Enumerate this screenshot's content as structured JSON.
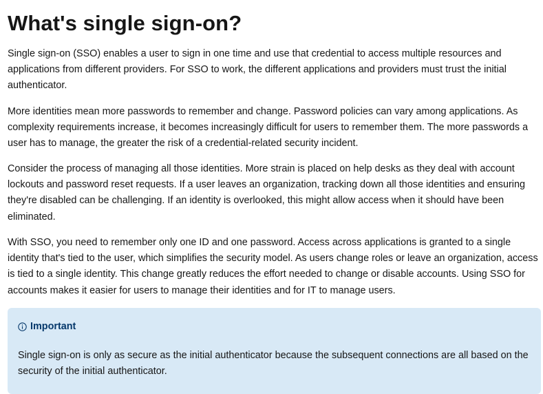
{
  "heading": "What's single sign-on?",
  "paragraphs": [
    "Single sign-on (SSO) enables a user to sign in one time and use that credential to access multiple resources and applications from different providers. For SSO to work, the different applications and providers must trust the initial authenticator.",
    "More identities mean more passwords to remember and change. Password policies can vary among applications. As complexity requirements increase, it becomes increasingly difficult for users to remember them. The more passwords a user has to manage, the greater the risk of a credential-related security incident.",
    "Consider the process of managing all those identities. More strain is placed on help desks as they deal with account lockouts and password reset requests. If a user leaves an organization, tracking down all those identities and ensuring they're disabled can be challenging. If an identity is overlooked, this might allow access when it should have been eliminated.",
    "With SSO, you need to remember only one ID and one password. Access across applications is granted to a single identity that's tied to the user, which simplifies the security model. As users change roles or leave an organization, access is tied to a single identity. This change greatly reduces the effort needed to change or disable accounts. Using SSO for accounts makes it easier for users to manage their identities and for IT to manage users."
  ],
  "alert": {
    "icon": "info-icon",
    "title": "Important",
    "body": "Single sign-on is only as secure as the initial authenticator because the subsequent connections are all based on the security of the initial authenticator."
  },
  "colors": {
    "alert_background": "#d8e9f6",
    "alert_title": "#05386b",
    "text": "#161616"
  }
}
